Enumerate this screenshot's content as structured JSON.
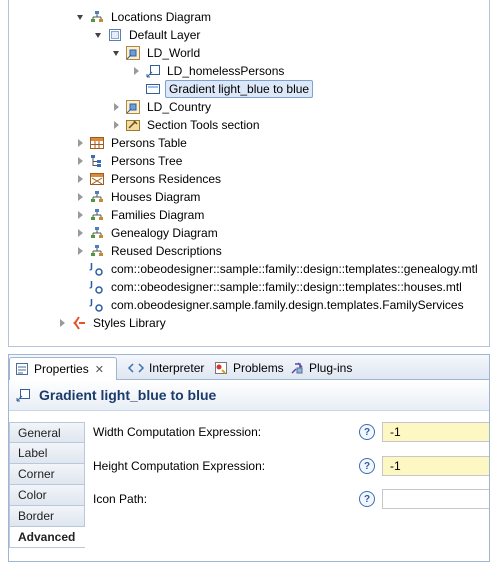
{
  "tree": {
    "items": [
      {
        "label": "Locations Diagram",
        "icon": "diagram-icon",
        "expander": "open"
      },
      {
        "label": "Default Layer",
        "icon": "layer-icon",
        "expander": "open"
      },
      {
        "label": "LD_World",
        "icon": "container-mapping-icon",
        "expander": "open"
      },
      {
        "label": "LD_homelessPersons",
        "icon": "node-mapping-icon",
        "expander": "closed"
      },
      {
        "label": "Gradient  light_blue to blue",
        "icon": "gradient-style-icon",
        "expander": "none",
        "selected": true
      },
      {
        "label": "LD_Country",
        "icon": "container-mapping-icon",
        "expander": "closed"
      },
      {
        "label": "Section Tools section",
        "icon": "tools-section-icon",
        "expander": "closed"
      },
      {
        "label": "Persons Table",
        "icon": "table-icon",
        "expander": "closed"
      },
      {
        "label": "Persons Tree",
        "icon": "tree-icon",
        "expander": "closed"
      },
      {
        "label": "Persons Residences",
        "icon": "cross-table-icon",
        "expander": "closed"
      },
      {
        "label": "Houses Diagram",
        "icon": "diagram-icon",
        "expander": "closed"
      },
      {
        "label": "Families Diagram",
        "icon": "diagram-icon",
        "expander": "closed"
      },
      {
        "label": "Genealogy Diagram",
        "icon": "diagram-icon",
        "expander": "closed"
      },
      {
        "label": "Reused Descriptions",
        "icon": "diagram-icon",
        "expander": "closed"
      },
      {
        "label": "com::obeodesigner::sample::family::design::templates::genealogy.mtl",
        "icon": "java-extension-icon",
        "expander": "none"
      },
      {
        "label": "com::obeodesigner::sample::family::design::templates::houses.mtl",
        "icon": "java-extension-icon",
        "expander": "none"
      },
      {
        "label": "com.obeodesigner.sample.family.design.templates.FamilyServices",
        "icon": "java-extension-icon",
        "expander": "none"
      },
      {
        "label": "Styles Library",
        "icon": "styles-library-icon",
        "expander": "closed"
      }
    ]
  },
  "tabs": [
    {
      "label": "Properties",
      "icon": "properties-icon",
      "active": true,
      "close": "✕"
    },
    {
      "label": "Interpreter",
      "icon": "interpreter-icon"
    },
    {
      "label": "Problems",
      "icon": "problems-icon"
    },
    {
      "label": "Plug-ins",
      "icon": "plugins-icon"
    }
  ],
  "header": {
    "title": "Gradient  light_blue to blue",
    "icon": "gradient-style-icon"
  },
  "side_tabs": [
    {
      "label": "General"
    },
    {
      "label": "Label"
    },
    {
      "label": "Corner"
    },
    {
      "label": "Color"
    },
    {
      "label": "Border"
    },
    {
      "label": "Advanced",
      "active": true
    }
  ],
  "fields": [
    {
      "label": "Width Computation Expression:",
      "value": "-1",
      "help": "?",
      "highlight": "#fdf7c3"
    },
    {
      "label": "Height Computation Expression:",
      "value": "-1",
      "help": "?",
      "highlight": "#fdf7c3"
    },
    {
      "label": "Icon Path:",
      "value": "",
      "help": "?"
    }
  ],
  "colors": {
    "selection_bg": "#dce8f7",
    "selection_border": "#7da2ce",
    "title": "#1b3b6a",
    "field_highlight": "#fdf7c3"
  }
}
